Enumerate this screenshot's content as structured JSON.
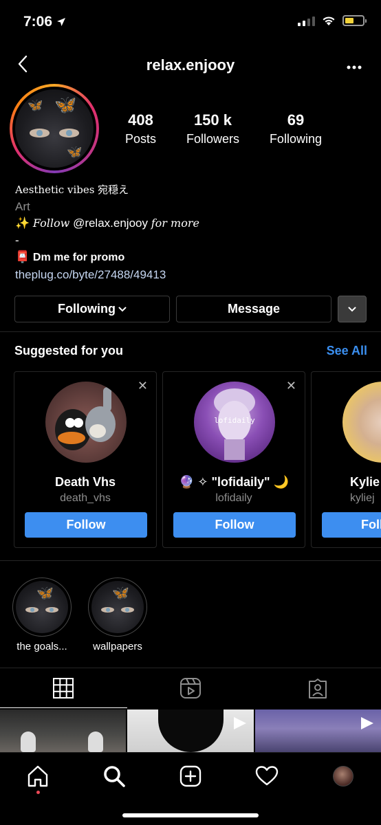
{
  "status_bar": {
    "time": "7:06",
    "battery_level": 0.5,
    "battery_color": "#f2d33a"
  },
  "header": {
    "username": "relax.enjooy",
    "more_label": "•••"
  },
  "profile": {
    "stats": [
      {
        "value": "408",
        "label": "Posts"
      },
      {
        "value": "150 k",
        "label": "Followers"
      },
      {
        "value": "69",
        "label": "Following"
      }
    ],
    "bio": {
      "line1": "Aesthetic vibes 宛穏え",
      "line2": "Art",
      "line3_emoji": "✨",
      "line3_pre": "Follow",
      "line3_mention": "@relax.enjooy",
      "line3_post": "for more",
      "line4": "-",
      "line5_emoji": "📮",
      "line5": "Dm me for promo",
      "link": "theplug.co/byte/27488/49413"
    }
  },
  "actions": {
    "following_label": "Following",
    "message_label": "Message"
  },
  "suggested": {
    "title": "Suggested for you",
    "see_all": "See All",
    "follow_label": "Follow",
    "cards": [
      {
        "name": "Death Vhs",
        "handle": "death_vhs"
      },
      {
        "name": "🔮 ✧ \"lofidaily\" 🌙",
        "handle": "lofidaily",
        "avatar_text": "lofidaily"
      },
      {
        "name": "Kylie",
        "handle": "kyliej"
      }
    ]
  },
  "highlights": [
    {
      "label": "the goals..."
    },
    {
      "label": "wallpapers"
    }
  ],
  "tabs": [
    {
      "icon": "grid-icon",
      "active": true
    },
    {
      "icon": "reels-icon",
      "active": false
    },
    {
      "icon": "tagged-icon",
      "active": false
    }
  ],
  "bottom_nav": [
    {
      "icon": "home-icon"
    },
    {
      "icon": "search-icon"
    },
    {
      "icon": "new-post-icon"
    },
    {
      "icon": "activity-heart-icon"
    },
    {
      "icon": "profile-avatar"
    }
  ],
  "colors": {
    "accent_blue": "#3d8ef0",
    "link_text": "#c6d7f2",
    "muted": "#8e8e8e",
    "notification_dot": "#ed4956"
  }
}
